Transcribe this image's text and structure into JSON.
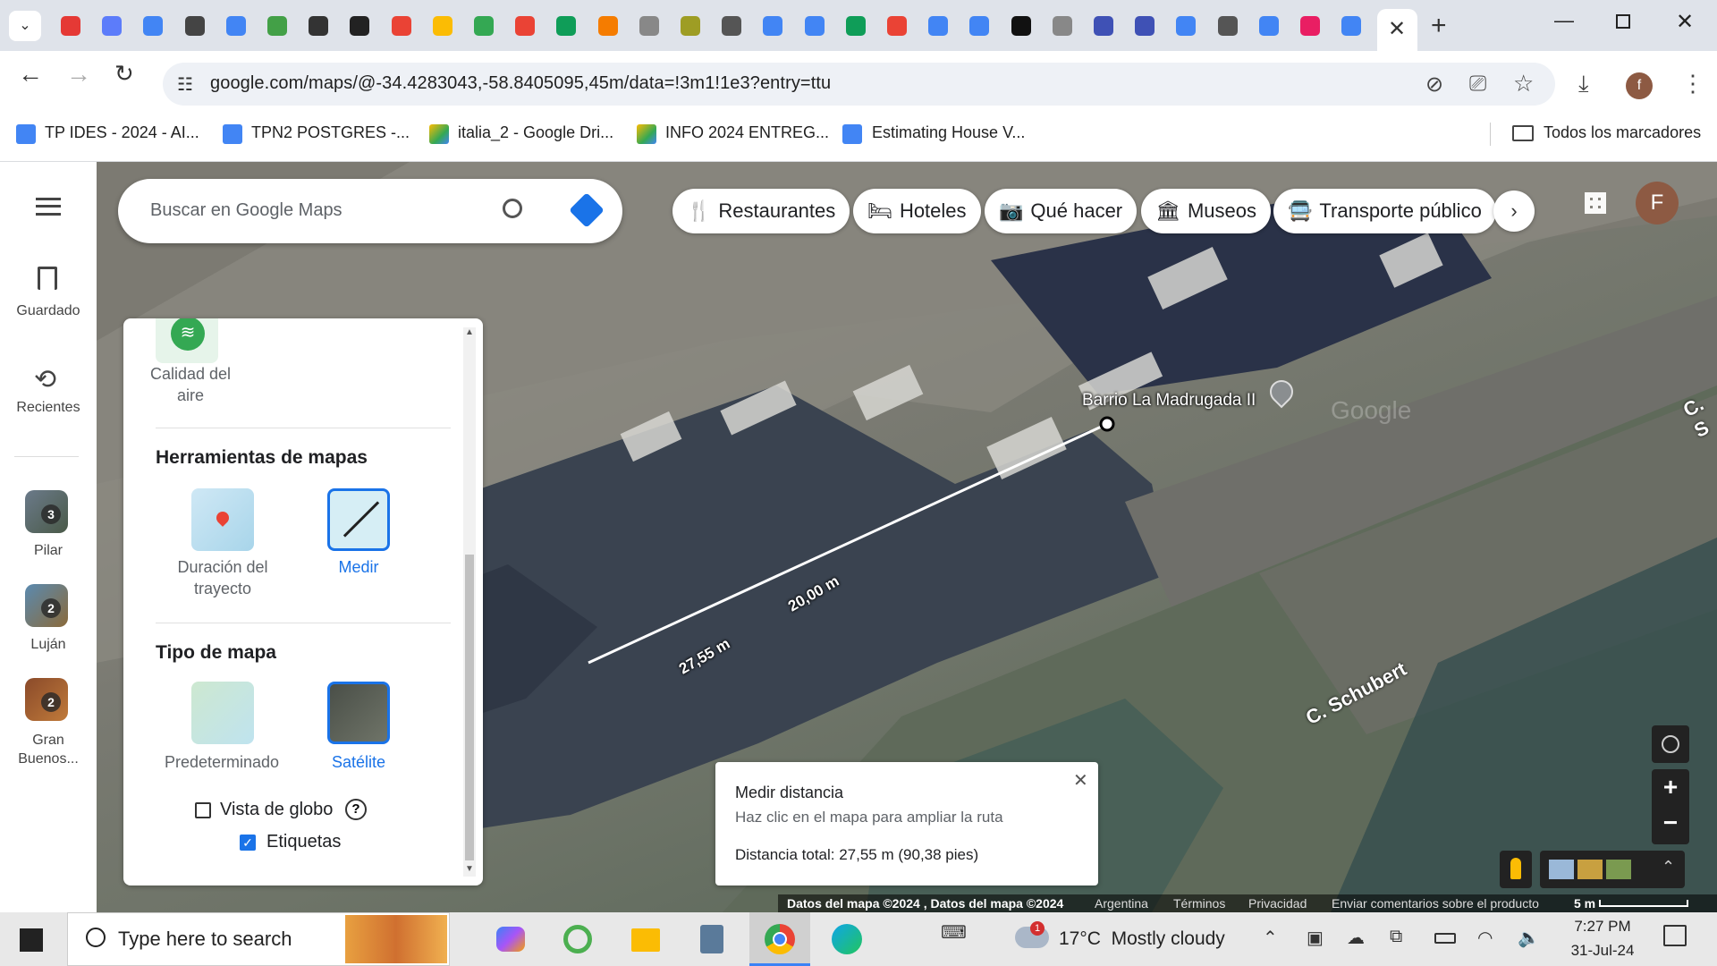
{
  "browser": {
    "url": "google.com/maps/@-34.4283043,-58.8405095,45m/data=!3m1!1e3?entry=ttu",
    "profile_initial": "f",
    "bookmarks": [
      {
        "label": "TP IDES - 2024 - AI...",
        "icon": "docs-icon",
        "color": "#4285f4"
      },
      {
        "label": "TPN2 POSTGRES -...",
        "icon": "docs-icon",
        "color": "#4285f4"
      },
      {
        "label": "italia_2 - Google Dri...",
        "icon": "drive-icon",
        "color": "#fbbc04"
      },
      {
        "label": "INFO 2024 ENTREG...",
        "icon": "drive-icon",
        "color": "#fbbc04"
      },
      {
        "label": "Estimating House V...",
        "icon": "docs-icon",
        "color": "#4285f4"
      }
    ],
    "all_bookmarks_label": "Todos los marcadores",
    "tab_favicons": [
      "#e53935",
      "#5c7cfa",
      "#4285f4",
      "#444",
      "#4285f4",
      "#43a047",
      "#333",
      "#222",
      "#ea4335",
      "#fbbc04",
      "#34a853",
      "#ea4335",
      "#0f9d58",
      "#f57c00",
      "#888",
      "#9e9d24",
      "#555",
      "#4285f4",
      "#4285f4",
      "#0f9d58",
      "#ea4335",
      "#4285f4",
      "#4285f4",
      "#111",
      "#888",
      "#3f51b5",
      "#3f51b5",
      "#4285f4",
      "#555",
      "#4285f4",
      "#e91e63",
      "#4285f4"
    ]
  },
  "maps": {
    "search_placeholder": "Buscar en Google Maps",
    "rail": {
      "saved": "Guardado",
      "recent": "Recientes",
      "places": [
        {
          "label": "Pilar",
          "count": "3"
        },
        {
          "label": "Luján",
          "count": "2"
        },
        {
          "label": "Gran Buenos...",
          "count": "2"
        }
      ]
    },
    "chips": [
      "Restaurantes",
      "Hoteles",
      "Qué hacer",
      "Museos",
      "Transporte público"
    ],
    "profile_initial": "F",
    "panel": {
      "air_quality": "Calidad del aire",
      "tools_heading": "Herramientas de mapas",
      "travel_time": "Duración del trayecto",
      "measure": "Medir",
      "map_type_heading": "Tipo de mapa",
      "default_type": "Predeterminado",
      "satellite_type": "Satélite",
      "globe_view": "Vista de globo",
      "labels": "Etiquetas",
      "globe_checked": false,
      "labels_checked": true
    },
    "map_labels": {
      "place_name": "Barrio La Madrugada II",
      "street": "C. Schubert",
      "street_edge": "C. S",
      "watermark": "Google",
      "segment_1": "20,00 m",
      "segment_2": "27,55 m"
    },
    "measure_popup": {
      "title": "Medir distancia",
      "hint": "Haz clic en el mapa para ampliar la ruta",
      "total": "Distancia total: 27,55 m (90,38 pies)"
    },
    "footer": {
      "data": "Datos del mapa ©2024 , Datos del mapa ©2024",
      "country": "Argentina",
      "terms": "Términos",
      "privacy": "Privacidad",
      "feedback": "Enviar comentarios sobre el producto",
      "scale": "5 m"
    }
  },
  "taskbar": {
    "search_placeholder": "Type here to search",
    "weather": "17°C  Mostly cloudy",
    "weather_badge": "1",
    "time": "7:27 PM",
    "date": "31-Jul-24"
  }
}
